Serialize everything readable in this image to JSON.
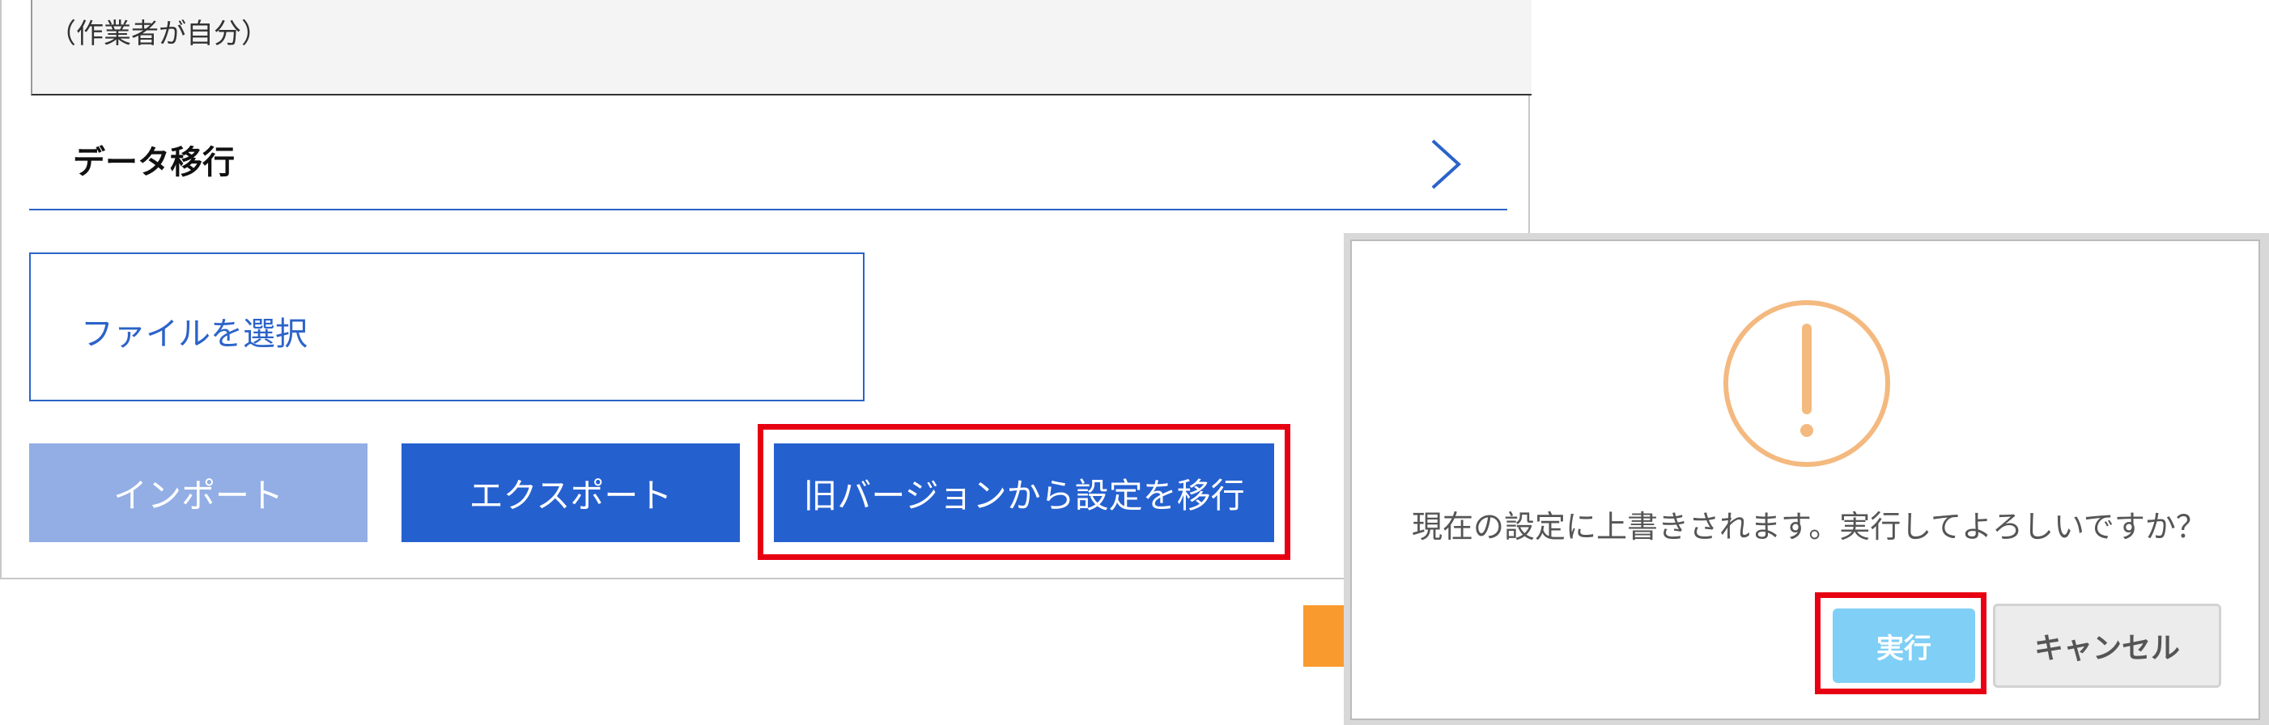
{
  "settings": {
    "worker_note": "（作業者が自分）",
    "section_title": "データ移行",
    "file_select_label": "ファイルを選択",
    "buttons": {
      "import": "インポート",
      "export": "エクスポート",
      "migrate": "旧バージョンから設定を移行"
    }
  },
  "dialog": {
    "message": "現在の設定に上書きされます。実行してよろしいですか？",
    "execute_label": "実行",
    "cancel_label": "キャンセル"
  },
  "colors": {
    "accent_blue": "#2560cf",
    "disabled_blue": "#92aee4",
    "highlight_red": "#e60012",
    "warning_orange": "#f4b97f",
    "arrow_orange": "#f99a2f",
    "execute_blue": "#7fcff6"
  },
  "icons": {
    "section_chevron": "chevron-right-icon",
    "warning": "exclamation-circle-icon",
    "flow_arrow": "arrow-right-icon"
  }
}
